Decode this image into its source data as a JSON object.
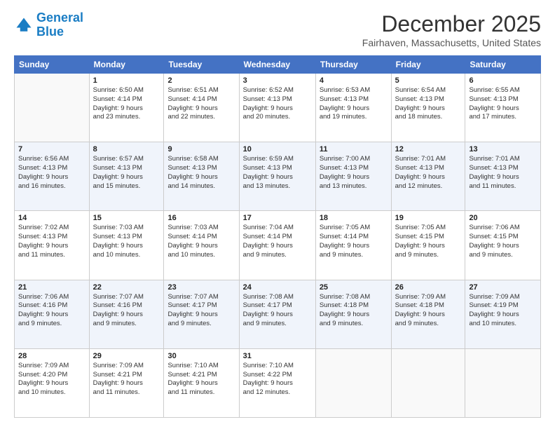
{
  "logo": {
    "line1": "General",
    "line2": "Blue"
  },
  "title": "December 2025",
  "location": "Fairhaven, Massachusetts, United States",
  "days_header": [
    "Sunday",
    "Monday",
    "Tuesday",
    "Wednesday",
    "Thursday",
    "Friday",
    "Saturday"
  ],
  "weeks": [
    [
      {
        "num": "",
        "info": ""
      },
      {
        "num": "1",
        "info": "Sunrise: 6:50 AM\nSunset: 4:14 PM\nDaylight: 9 hours\nand 23 minutes."
      },
      {
        "num": "2",
        "info": "Sunrise: 6:51 AM\nSunset: 4:14 PM\nDaylight: 9 hours\nand 22 minutes."
      },
      {
        "num": "3",
        "info": "Sunrise: 6:52 AM\nSunset: 4:13 PM\nDaylight: 9 hours\nand 20 minutes."
      },
      {
        "num": "4",
        "info": "Sunrise: 6:53 AM\nSunset: 4:13 PM\nDaylight: 9 hours\nand 19 minutes."
      },
      {
        "num": "5",
        "info": "Sunrise: 6:54 AM\nSunset: 4:13 PM\nDaylight: 9 hours\nand 18 minutes."
      },
      {
        "num": "6",
        "info": "Sunrise: 6:55 AM\nSunset: 4:13 PM\nDaylight: 9 hours\nand 17 minutes."
      }
    ],
    [
      {
        "num": "7",
        "info": "Sunrise: 6:56 AM\nSunset: 4:13 PM\nDaylight: 9 hours\nand 16 minutes."
      },
      {
        "num": "8",
        "info": "Sunrise: 6:57 AM\nSunset: 4:13 PM\nDaylight: 9 hours\nand 15 minutes."
      },
      {
        "num": "9",
        "info": "Sunrise: 6:58 AM\nSunset: 4:13 PM\nDaylight: 9 hours\nand 14 minutes."
      },
      {
        "num": "10",
        "info": "Sunrise: 6:59 AM\nSunset: 4:13 PM\nDaylight: 9 hours\nand 13 minutes."
      },
      {
        "num": "11",
        "info": "Sunrise: 7:00 AM\nSunset: 4:13 PM\nDaylight: 9 hours\nand 13 minutes."
      },
      {
        "num": "12",
        "info": "Sunrise: 7:01 AM\nSunset: 4:13 PM\nDaylight: 9 hours\nand 12 minutes."
      },
      {
        "num": "13",
        "info": "Sunrise: 7:01 AM\nSunset: 4:13 PM\nDaylight: 9 hours\nand 11 minutes."
      }
    ],
    [
      {
        "num": "14",
        "info": "Sunrise: 7:02 AM\nSunset: 4:13 PM\nDaylight: 9 hours\nand 11 minutes."
      },
      {
        "num": "15",
        "info": "Sunrise: 7:03 AM\nSunset: 4:13 PM\nDaylight: 9 hours\nand 10 minutes."
      },
      {
        "num": "16",
        "info": "Sunrise: 7:03 AM\nSunset: 4:14 PM\nDaylight: 9 hours\nand 10 minutes."
      },
      {
        "num": "17",
        "info": "Sunrise: 7:04 AM\nSunset: 4:14 PM\nDaylight: 9 hours\nand 9 minutes."
      },
      {
        "num": "18",
        "info": "Sunrise: 7:05 AM\nSunset: 4:14 PM\nDaylight: 9 hours\nand 9 minutes."
      },
      {
        "num": "19",
        "info": "Sunrise: 7:05 AM\nSunset: 4:15 PM\nDaylight: 9 hours\nand 9 minutes."
      },
      {
        "num": "20",
        "info": "Sunrise: 7:06 AM\nSunset: 4:15 PM\nDaylight: 9 hours\nand 9 minutes."
      }
    ],
    [
      {
        "num": "21",
        "info": "Sunrise: 7:06 AM\nSunset: 4:16 PM\nDaylight: 9 hours\nand 9 minutes."
      },
      {
        "num": "22",
        "info": "Sunrise: 7:07 AM\nSunset: 4:16 PM\nDaylight: 9 hours\nand 9 minutes."
      },
      {
        "num": "23",
        "info": "Sunrise: 7:07 AM\nSunset: 4:17 PM\nDaylight: 9 hours\nand 9 minutes."
      },
      {
        "num": "24",
        "info": "Sunrise: 7:08 AM\nSunset: 4:17 PM\nDaylight: 9 hours\nand 9 minutes."
      },
      {
        "num": "25",
        "info": "Sunrise: 7:08 AM\nSunset: 4:18 PM\nDaylight: 9 hours\nand 9 minutes."
      },
      {
        "num": "26",
        "info": "Sunrise: 7:09 AM\nSunset: 4:18 PM\nDaylight: 9 hours\nand 9 minutes."
      },
      {
        "num": "27",
        "info": "Sunrise: 7:09 AM\nSunset: 4:19 PM\nDaylight: 9 hours\nand 10 minutes."
      }
    ],
    [
      {
        "num": "28",
        "info": "Sunrise: 7:09 AM\nSunset: 4:20 PM\nDaylight: 9 hours\nand 10 minutes."
      },
      {
        "num": "29",
        "info": "Sunrise: 7:09 AM\nSunset: 4:21 PM\nDaylight: 9 hours\nand 11 minutes."
      },
      {
        "num": "30",
        "info": "Sunrise: 7:10 AM\nSunset: 4:21 PM\nDaylight: 9 hours\nand 11 minutes."
      },
      {
        "num": "31",
        "info": "Sunrise: 7:10 AM\nSunset: 4:22 PM\nDaylight: 9 hours\nand 12 minutes."
      },
      {
        "num": "",
        "info": ""
      },
      {
        "num": "",
        "info": ""
      },
      {
        "num": "",
        "info": ""
      }
    ]
  ]
}
